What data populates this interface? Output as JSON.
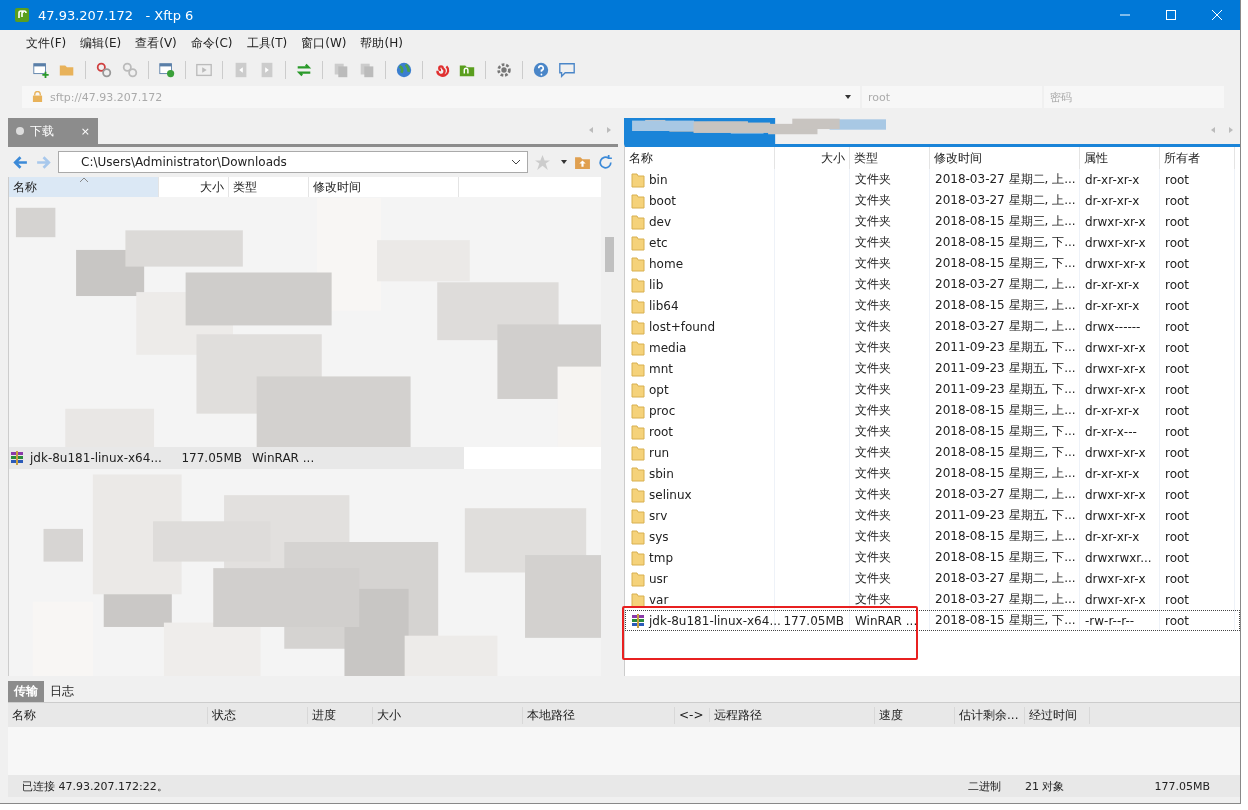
{
  "window": {
    "title": "47.93.207.172   - Xftp 6"
  },
  "menu": [
    "文件(F)",
    "编辑(E)",
    "查看(V)",
    "命令(C)",
    "工具(T)",
    "窗口(W)",
    "帮助(H)"
  ],
  "address_bar": {
    "placeholder": "sftp://47.93.207.172",
    "user_placeholder": "root",
    "password_placeholder": "密码"
  },
  "left_panel": {
    "tab": {
      "label": "下载",
      "close": "×"
    },
    "path": "C:\\Users\\Administrator\\Downloads",
    "columns": [
      "名称",
      "大小",
      "类型",
      "修改时间"
    ],
    "visible_row": {
      "name": "jdk-8u181-linux-x64...",
      "size": "177.05MB",
      "type": "WinRAR ..."
    }
  },
  "right_panel": {
    "columns": [
      "名称",
      "大小",
      "类型",
      "修改时间",
      "属性",
      "所有者"
    ],
    "rows": [
      {
        "kind": "folder",
        "name": "bin",
        "size": "",
        "type": "文件夹",
        "modified": "2018-03-27 星期二, 上...",
        "attributes": "dr-xr-xr-x",
        "owner": "root",
        "selected": false
      },
      {
        "kind": "folder",
        "name": "boot",
        "size": "",
        "type": "文件夹",
        "modified": "2018-03-27 星期二, 上...",
        "attributes": "dr-xr-xr-x",
        "owner": "root",
        "selected": false
      },
      {
        "kind": "folder",
        "name": "dev",
        "size": "",
        "type": "文件夹",
        "modified": "2018-08-15 星期三, 上...",
        "attributes": "drwxr-xr-x",
        "owner": "root",
        "selected": false
      },
      {
        "kind": "folder",
        "name": "etc",
        "size": "",
        "type": "文件夹",
        "modified": "2018-08-15 星期三, 下...",
        "attributes": "drwxr-xr-x",
        "owner": "root",
        "selected": false
      },
      {
        "kind": "folder",
        "name": "home",
        "size": "",
        "type": "文件夹",
        "modified": "2018-08-15 星期三, 下...",
        "attributes": "drwxr-xr-x",
        "owner": "root",
        "selected": false
      },
      {
        "kind": "folder",
        "name": "lib",
        "size": "",
        "type": "文件夹",
        "modified": "2018-03-27 星期二, 上...",
        "attributes": "dr-xr-xr-x",
        "owner": "root",
        "selected": false
      },
      {
        "kind": "folder",
        "name": "lib64",
        "size": "",
        "type": "文件夹",
        "modified": "2018-08-15 星期三, 上...",
        "attributes": "dr-xr-xr-x",
        "owner": "root",
        "selected": false
      },
      {
        "kind": "folder",
        "name": "lost+found",
        "size": "",
        "type": "文件夹",
        "modified": "2018-03-27 星期二, 上...",
        "attributes": "drwx------",
        "owner": "root",
        "selected": false
      },
      {
        "kind": "folder",
        "name": "media",
        "size": "",
        "type": "文件夹",
        "modified": "2011-09-23 星期五, 下...",
        "attributes": "drwxr-xr-x",
        "owner": "root",
        "selected": false
      },
      {
        "kind": "folder",
        "name": "mnt",
        "size": "",
        "type": "文件夹",
        "modified": "2011-09-23 星期五, 下...",
        "attributes": "drwxr-xr-x",
        "owner": "root",
        "selected": false
      },
      {
        "kind": "folder",
        "name": "opt",
        "size": "",
        "type": "文件夹",
        "modified": "2011-09-23 星期五, 下...",
        "attributes": "drwxr-xr-x",
        "owner": "root",
        "selected": false
      },
      {
        "kind": "folder",
        "name": "proc",
        "size": "",
        "type": "文件夹",
        "modified": "2018-08-15 星期三, 上...",
        "attributes": "dr-xr-xr-x",
        "owner": "root",
        "selected": false
      },
      {
        "kind": "folder",
        "name": "root",
        "size": "",
        "type": "文件夹",
        "modified": "2018-08-15 星期三, 下...",
        "attributes": "dr-xr-x---",
        "owner": "root",
        "selected": false
      },
      {
        "kind": "folder",
        "name": "run",
        "size": "",
        "type": "文件夹",
        "modified": "2018-08-15 星期三, 下...",
        "attributes": "drwxr-xr-x",
        "owner": "root",
        "selected": false
      },
      {
        "kind": "folder",
        "name": "sbin",
        "size": "",
        "type": "文件夹",
        "modified": "2018-08-15 星期三, 上...",
        "attributes": "dr-xr-xr-x",
        "owner": "root",
        "selected": false
      },
      {
        "kind": "folder",
        "name": "selinux",
        "size": "",
        "type": "文件夹",
        "modified": "2018-03-27 星期二, 上...",
        "attributes": "drwxr-xr-x",
        "owner": "root",
        "selected": false
      },
      {
        "kind": "folder",
        "name": "srv",
        "size": "",
        "type": "文件夹",
        "modified": "2011-09-23 星期五, 下...",
        "attributes": "drwxr-xr-x",
        "owner": "root",
        "selected": false
      },
      {
        "kind": "folder",
        "name": "sys",
        "size": "",
        "type": "文件夹",
        "modified": "2018-08-15 星期三, 上...",
        "attributes": "dr-xr-xr-x",
        "owner": "root",
        "selected": false
      },
      {
        "kind": "folder",
        "name": "tmp",
        "size": "",
        "type": "文件夹",
        "modified": "2018-08-15 星期三, 下...",
        "attributes": "drwxrwxr...",
        "owner": "root",
        "selected": false
      },
      {
        "kind": "folder",
        "name": "usr",
        "size": "",
        "type": "文件夹",
        "modified": "2018-03-27 星期二, 上...",
        "attributes": "drwxr-xr-x",
        "owner": "root",
        "selected": false
      },
      {
        "kind": "folder",
        "name": "var",
        "size": "",
        "type": "文件夹",
        "modified": "2018-03-27 星期二, 上...",
        "attributes": "drwxr-xr-x",
        "owner": "root",
        "selected": false
      },
      {
        "kind": "archive",
        "name": "jdk-8u181-linux-x64...",
        "size": "177.05MB",
        "type": "WinRAR ...",
        "modified": "2018-08-15 星期三, 下...",
        "attributes": "-rw-r--r--",
        "owner": "root",
        "selected": true
      }
    ]
  },
  "transfer": {
    "tabs": [
      {
        "label": "传输",
        "selected": true
      },
      {
        "label": "日志",
        "selected": false
      }
    ],
    "columns": [
      "名称",
      "状态",
      "进度",
      "大小",
      "本地路径",
      "<->",
      "远程路径",
      "速度",
      "估计剩余...",
      "经过时间"
    ]
  },
  "status_bar": {
    "connection": "已连接 47.93.207.172:22。",
    "mode": "二进制",
    "objects": "21 对象",
    "size": "177.05MB"
  }
}
